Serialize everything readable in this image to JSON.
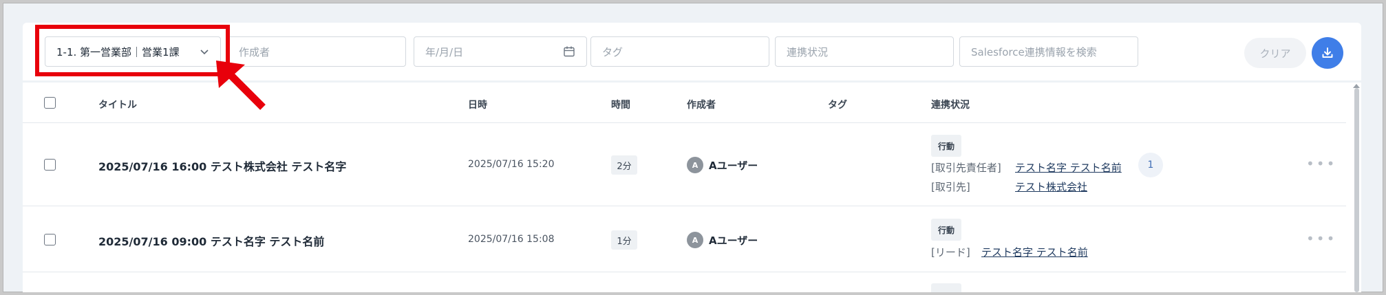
{
  "filters": {
    "department_value": "1-1.  第一営業部｜営業1課",
    "creator_placeholder": "作成者",
    "date_placeholder": "年/月/日",
    "tag_placeholder": "タグ",
    "sync_status_placeholder": "連携状況",
    "salesforce_search_placeholder": "Salesforce連携情報を検索",
    "clear_label": "クリア"
  },
  "table": {
    "headers": {
      "title": "タイトル",
      "datetime": "日時",
      "duration": "時間",
      "creator": "作成者",
      "tag": "タグ",
      "sync_status": "連携状況"
    },
    "rows": [
      {
        "title": "2025/07/16 16:00 テスト株式会社 テスト名字",
        "datetime": "2025/07/16 15:20",
        "duration": "2分",
        "creator_initial": "A",
        "creator": "Aユーザー",
        "kind": "行動",
        "links": [
          {
            "role": "[取引先責任者]",
            "name": "テスト名字 テスト名前"
          },
          {
            "role": "[取引先]",
            "name": "テスト株式会社"
          }
        ],
        "count": "1"
      },
      {
        "title": "2025/07/16 09:00 テスト名字 テスト名前",
        "datetime": "2025/07/16 15:08",
        "duration": "1分",
        "creator_initial": "A",
        "creator": "Aユーザー",
        "kind": "行動",
        "links": [
          {
            "role": "[リード]",
            "name": "テスト名字 テスト名前"
          }
        ]
      }
    ]
  },
  "colors": {
    "highlight": "#e8000b",
    "download_button": "#3f7ee8"
  }
}
